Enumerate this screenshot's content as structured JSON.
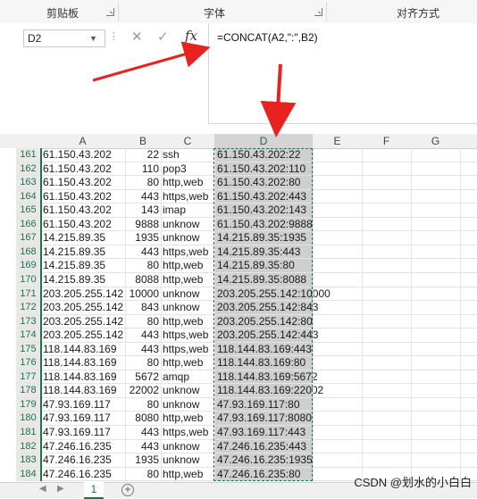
{
  "ribbon": {
    "groups": [
      "剪贴板",
      "字体",
      "对齐方式"
    ]
  },
  "formula_bar": {
    "name_box": "D2",
    "cancel_icon": "✕",
    "enter_icon": "✓",
    "fx_label": "fx",
    "formula": "=CONCAT(A2,\":\",B2)"
  },
  "columns": [
    "A",
    "B",
    "C",
    "D",
    "E",
    "F",
    "G"
  ],
  "rows": [
    {
      "n": "161",
      "a": "61.150.43.202",
      "b": "22",
      "c": "ssh",
      "d": "61.150.43.202:22"
    },
    {
      "n": "162",
      "a": "61.150.43.202",
      "b": "110",
      "c": "pop3",
      "d": "61.150.43.202:110"
    },
    {
      "n": "163",
      "a": "61.150.43.202",
      "b": "80",
      "c": "http,web",
      "d": "61.150.43.202:80"
    },
    {
      "n": "164",
      "a": "61.150.43.202",
      "b": "443",
      "c": "https,web",
      "d": "61.150.43.202:443"
    },
    {
      "n": "165",
      "a": "61.150.43.202",
      "b": "143",
      "c": "imap",
      "d": "61.150.43.202:143"
    },
    {
      "n": "166",
      "a": "61.150.43.202",
      "b": "9888",
      "c": "unknow",
      "d": "61.150.43.202:9888"
    },
    {
      "n": "167",
      "a": "14.215.89.35",
      "b": "1935",
      "c": "unknow",
      "d": "14.215.89.35:1935"
    },
    {
      "n": "168",
      "a": "14.215.89.35",
      "b": "443",
      "c": "https,web",
      "d": "14.215.89.35:443"
    },
    {
      "n": "169",
      "a": "14.215.89.35",
      "b": "80",
      "c": "http,web",
      "d": "14.215.89.35:80"
    },
    {
      "n": "170",
      "a": "14.215.89.35",
      "b": "8088",
      "c": "http,web",
      "d": "14.215.89.35:8088"
    },
    {
      "n": "171",
      "a": "203.205.255.142",
      "b": "10000",
      "c": "unknow",
      "d": "203.205.255.142:10000"
    },
    {
      "n": "172",
      "a": "203.205.255.142",
      "b": "843",
      "c": "unknow",
      "d": "203.205.255.142:843"
    },
    {
      "n": "173",
      "a": "203.205.255.142",
      "b": "80",
      "c": "http,web",
      "d": "203.205.255.142:80"
    },
    {
      "n": "174",
      "a": "203.205.255.142",
      "b": "443",
      "c": "https,web",
      "d": "203.205.255.142:443"
    },
    {
      "n": "175",
      "a": "118.144.83.169",
      "b": "443",
      "c": "https,web",
      "d": "118.144.83.169:443"
    },
    {
      "n": "176",
      "a": "118.144.83.169",
      "b": "80",
      "c": "http,web",
      "d": "118.144.83.169:80"
    },
    {
      "n": "177",
      "a": "118.144.83.169",
      "b": "5672",
      "c": "amqp",
      "d": "118.144.83.169:5672"
    },
    {
      "n": "178",
      "a": "118.144.83.169",
      "b": "22002",
      "c": "unknow",
      "d": "118.144.83.169:22002"
    },
    {
      "n": "179",
      "a": "47.93.169.117",
      "b": "80",
      "c": "unknow",
      "d": "47.93.169.117:80"
    },
    {
      "n": "180",
      "a": "47.93.169.117",
      "b": "8080",
      "c": "http,web",
      "d": "47.93.169.117:8080"
    },
    {
      "n": "181",
      "a": "47.93.169.117",
      "b": "443",
      "c": "https,web",
      "d": "47.93.169.117:443"
    },
    {
      "n": "182",
      "a": "47.246.16.235",
      "b": "443",
      "c": "unknow",
      "d": "47.246.16.235:443"
    },
    {
      "n": "183",
      "a": "47.246.16.235",
      "b": "1935",
      "c": "unknow",
      "d": "47.246.16.235:1935"
    },
    {
      "n": "184",
      "a": "47.246.16.235",
      "b": "80",
      "c": "http,web",
      "d": "47.246.16.235:80"
    }
  ],
  "sheet_tab": "1",
  "add_sheet": "+",
  "watermark": "CSDN @划水的小白白",
  "colors": {
    "accent": "#217346",
    "arrow": "#e8231f",
    "selection": "#cfcfcf"
  }
}
